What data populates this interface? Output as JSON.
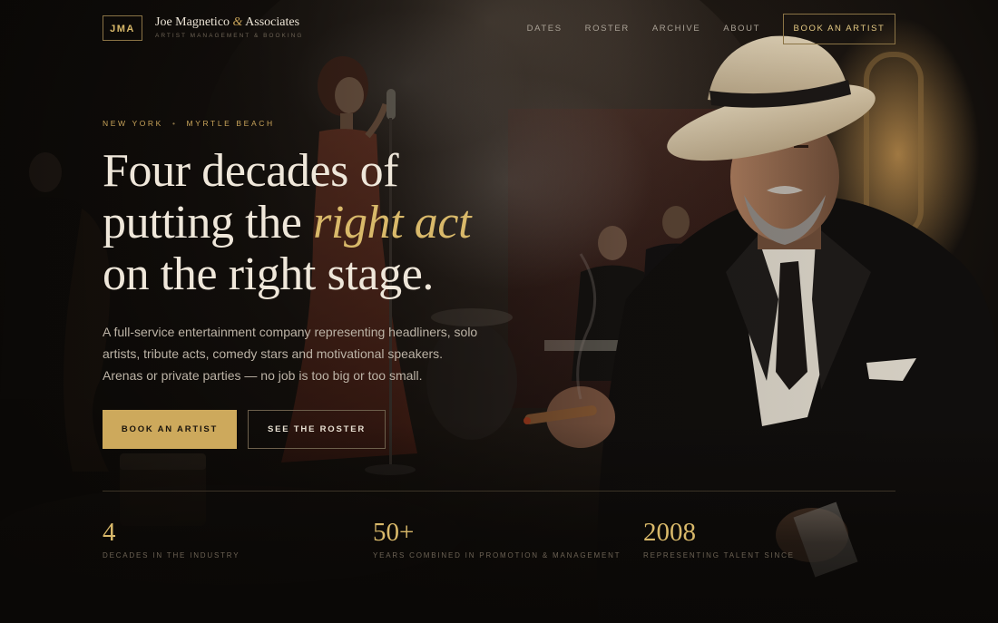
{
  "brand": {
    "monogram": "JMA",
    "name_part1": "Joe Magnetico ",
    "name_amp": "&",
    "name_part2": " Associates",
    "tagline": "ARTIST MANAGEMENT & BOOKING"
  },
  "nav": {
    "links": [
      "DATES",
      "ROSTER",
      "ARCHIVE",
      "ABOUT"
    ],
    "cta": "BOOK AN ARTIST"
  },
  "hero": {
    "locations": [
      "NEW YORK",
      "MYRTLE BEACH"
    ],
    "separator": "•",
    "headline_line1": "Four decades of",
    "headline_line2_pre": "putting the ",
    "headline_line2_em": "right act",
    "headline_line3": "on the right stage.",
    "lede": "A full-service entertainment company representing headliners, solo artists, tribute acts, comedy stars and motivational speakers. Arenas or private parties — no job is too big or too small.",
    "primary_button": "BOOK AN ARTIST",
    "secondary_button": "SEE THE ROSTER"
  },
  "stats": [
    {
      "value": "4",
      "label": "DECADES IN THE INDUSTRY"
    },
    {
      "value": "50+",
      "label": "YEARS COMBINED IN PROMOTION & MANAGEMENT"
    },
    {
      "value": "2008",
      "label": "REPRESENTING TALENT SINCE"
    }
  ],
  "colors": {
    "accent": "#cda95c",
    "background": "#0c0a08",
    "text": "#efe7da"
  }
}
